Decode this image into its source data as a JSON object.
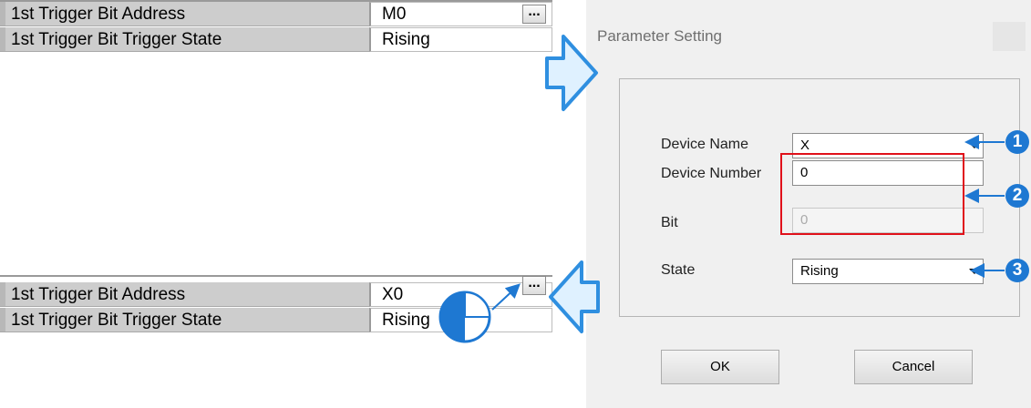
{
  "grid_before": {
    "rows": [
      {
        "label": "1st Trigger Bit Address",
        "value": "M0"
      },
      {
        "label": "1st Trigger Bit Trigger State",
        "value": "Rising"
      }
    ],
    "ellipsis": "..."
  },
  "grid_after": {
    "rows": [
      {
        "label": "1st Trigger Bit Address",
        "value": "X0"
      },
      {
        "label": "1st Trigger Bit Trigger State",
        "value": "Rising"
      }
    ],
    "ellipsis": "..."
  },
  "dialog": {
    "title": "Parameter Setting",
    "device_name": {
      "label": "Device Name",
      "value": "X"
    },
    "device_number": {
      "label": "Device Number",
      "value": "0"
    },
    "bit": {
      "label": "Bit",
      "value": "0"
    },
    "state": {
      "label": "State",
      "value": "Rising"
    },
    "ok": "OK",
    "cancel": "Cancel"
  },
  "callouts": [
    "1",
    "2",
    "3"
  ],
  "colors": {
    "arrow": "#4aa3e6",
    "badge": "#1e78d2",
    "highlight": "#e0101a"
  }
}
